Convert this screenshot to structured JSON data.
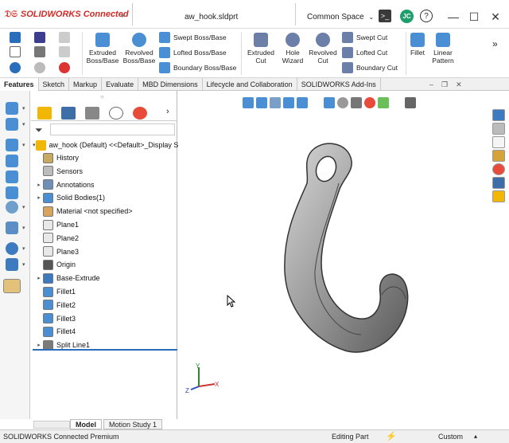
{
  "title_bar": {
    "logo": "SOLIDWORKS Connected",
    "document": "aw_hook.sldprt",
    "space": "Common Space",
    "user_initials": "JC",
    "help": "?",
    "minimize": "—",
    "maximize": "☐",
    "close": "✕"
  },
  "ribbon": {
    "large_buttons": [
      "Extruded\nBoss/Base",
      "Revolved\nBoss/Base",
      "Extruded\nCut",
      "Hole\nWizard",
      "Revolved\nCut",
      "Fillet",
      "Linear\nPattern"
    ],
    "boss_small": [
      "Swept Boss/Base",
      "Lofted Boss/Base",
      "Boundary Boss/Base"
    ],
    "cut_small": [
      "Swept Cut",
      "Lofted Cut",
      "Boundary Cut"
    ],
    "overflow": "»"
  },
  "command_tabs": [
    "Features",
    "Sketch",
    "Markup",
    "Evaluate",
    "MBD Dimensions",
    "Lifecycle and Collaboration",
    "SOLIDWORKS Add-Ins"
  ],
  "active_tab": "Features",
  "feature_tree": {
    "root": "aw_hook (Default) <<Default>_Display S",
    "items": [
      {
        "label": "History",
        "expandable": false
      },
      {
        "label": "Sensors",
        "expandable": false
      },
      {
        "label": "Annotations",
        "expandable": true
      },
      {
        "label": "Solid Bodies(1)",
        "expandable": true
      },
      {
        "label": "Material <not specified>",
        "expandable": false
      },
      {
        "label": "Plane1",
        "expandable": false
      },
      {
        "label": "Plane2",
        "expandable": false
      },
      {
        "label": "Plane3",
        "expandable": false
      },
      {
        "label": "Origin",
        "expandable": false
      },
      {
        "label": "Base-Extrude",
        "expandable": true
      },
      {
        "label": "Fillet1",
        "expandable": false
      },
      {
        "label": "Fillet2",
        "expandable": false
      },
      {
        "label": "Fillet3",
        "expandable": false
      },
      {
        "label": "Fillet4",
        "expandable": false
      },
      {
        "label": "Split Line1",
        "expandable": true
      }
    ]
  },
  "bottom_tabs": [
    "Model",
    "Motion Study 1"
  ],
  "status_bar": {
    "product": "SOLIDWORKS Connected Premium",
    "mode": "Editing Part",
    "units": "Custom"
  },
  "triad": {
    "x": "X",
    "y": "Y",
    "z": "Z"
  },
  "colors": {
    "brand_red": "#d02b26",
    "avatar": "#1e9e6d",
    "model_gray": "#9a9a9a",
    "accent_blue": "#2a6ebb"
  }
}
